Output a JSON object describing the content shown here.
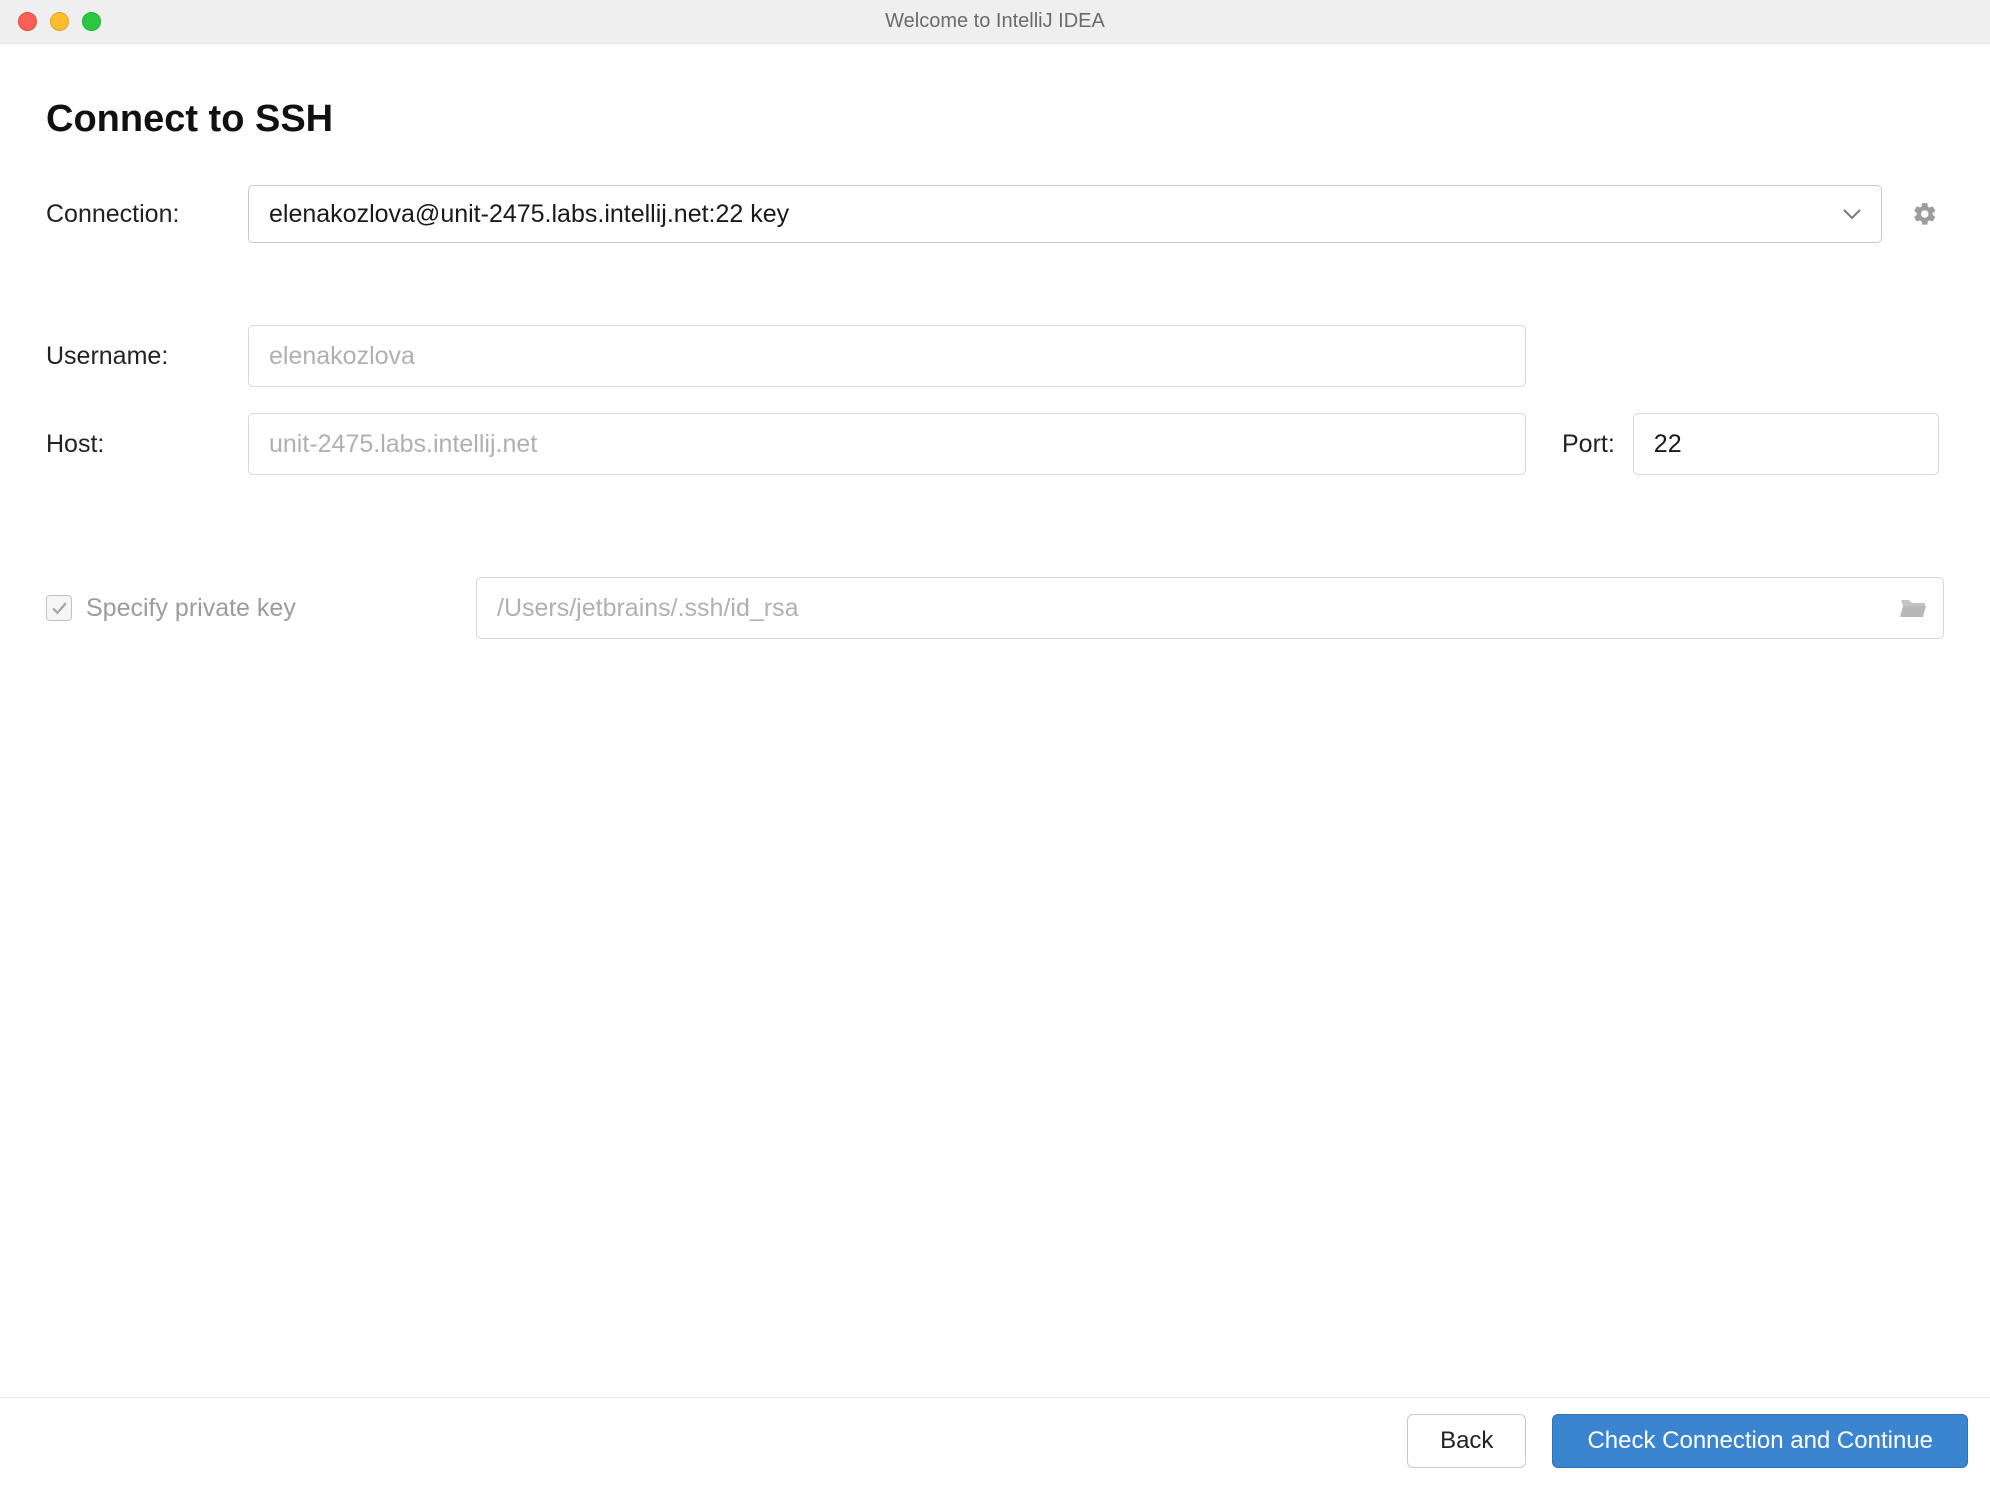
{
  "window": {
    "title": "Welcome to IntelliJ IDEA"
  },
  "page": {
    "heading": "Connect to SSH"
  },
  "connection": {
    "label": "Connection:",
    "selected": "elenakozlova@unit-2475.labs.intellij.net:22 key"
  },
  "fields": {
    "username_label": "Username:",
    "username_placeholder": "elenakozlova",
    "host_label": "Host:",
    "host_placeholder": "unit-2475.labs.intellij.net",
    "port_label": "Port:",
    "port_value": "22"
  },
  "private_key": {
    "checkbox_label": "Specify private key",
    "checked": true,
    "path": "/Users/jetbrains/.ssh/id_rsa"
  },
  "footer": {
    "back": "Back",
    "continue": "Check Connection and Continue"
  }
}
